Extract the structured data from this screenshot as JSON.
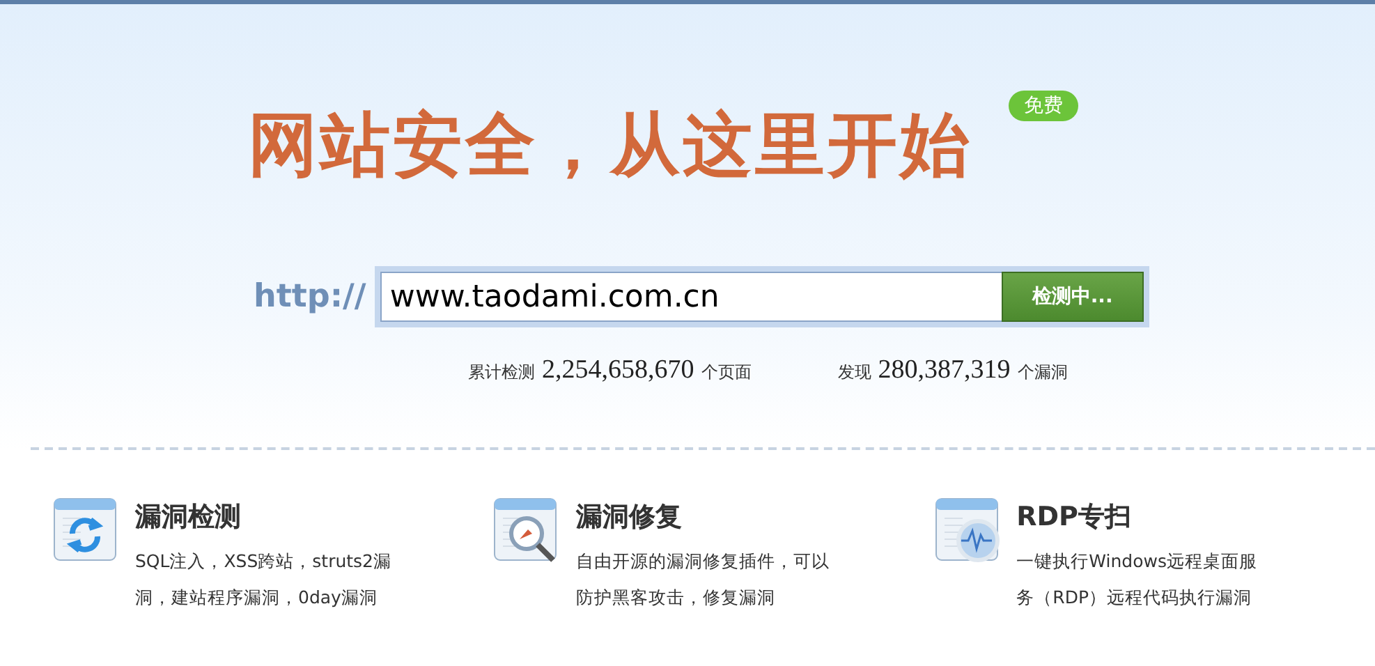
{
  "headline": "网站安全，从这里开始",
  "badge": "免费",
  "search": {
    "prefix": "http://",
    "value": "www.taodami.com.cn",
    "button": "检测中..."
  },
  "stats": [
    {
      "label": "累计检测",
      "number": "2,254,658,670",
      "unit": "个页面"
    },
    {
      "label": "发现",
      "number": "280,387,319",
      "unit": "个漏洞"
    }
  ],
  "features": [
    {
      "kind": "refresh",
      "title": "漏洞检测",
      "lines": [
        "SQL注入，XSS跨站，struts2漏",
        "洞，建站程序漏洞，0day漏洞"
      ]
    },
    {
      "kind": "magnifier",
      "title": "漏洞修复",
      "lines": [
        "自由开源的漏洞修复插件，可以",
        "防护黑客攻击，修复漏洞"
      ]
    },
    {
      "kind": "pulse",
      "title": "RDP专扫",
      "lines": [
        "一键执行Windows远程桌面服",
        "务（RDP）远程代码执行漏洞"
      ]
    }
  ]
}
